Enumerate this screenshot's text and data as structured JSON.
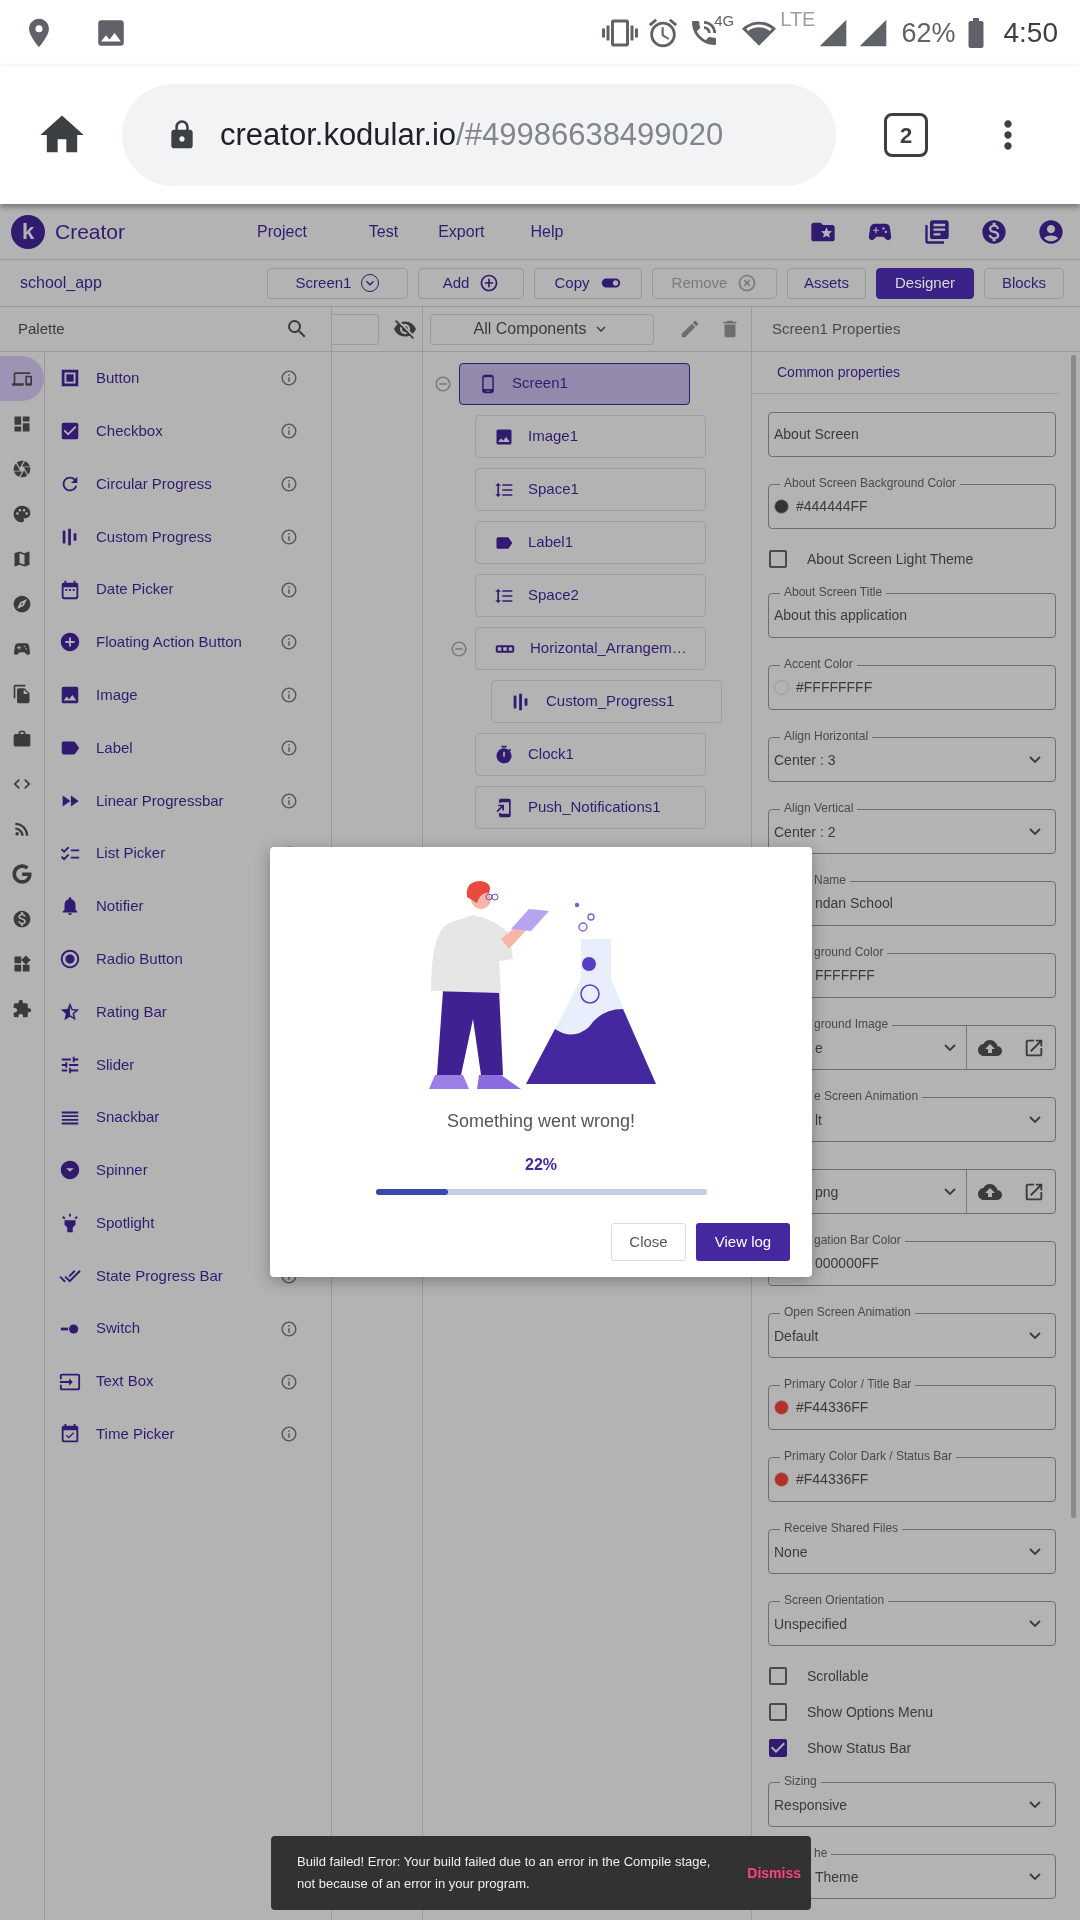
{
  "status_bar": {
    "network": "4G",
    "lte": "LTE",
    "battery": "62%",
    "time": "4:50"
  },
  "browser": {
    "url_host": "creator.kodular.io",
    "url_path": "/#49986638499020",
    "tab_count": "2"
  },
  "app_header": {
    "logo": "k",
    "title": "Creator",
    "menu": [
      "Project",
      "Test",
      "Export",
      "Help"
    ]
  },
  "toolbar": {
    "project": "school_app",
    "actions": [
      {
        "label": "Screen1",
        "kind": "dropdown",
        "disabled": false
      },
      {
        "label": "Add",
        "kind": "add",
        "disabled": false
      },
      {
        "label": "Copy",
        "kind": "copy",
        "disabled": false
      },
      {
        "label": "Remove",
        "kind": "remove",
        "disabled": true
      }
    ],
    "views": [
      {
        "label": "Assets",
        "selected": false
      },
      {
        "label": "Designer",
        "selected": true
      },
      {
        "label": "Blocks",
        "selected": false
      }
    ]
  },
  "palette": {
    "title": "Palette",
    "rail": [
      {
        "kind": "devices",
        "selected": true
      },
      {
        "kind": "layout",
        "selected": false
      },
      {
        "kind": "media",
        "selected": false
      },
      {
        "kind": "palette",
        "selected": false
      },
      {
        "kind": "map",
        "selected": false
      },
      {
        "kind": "compass",
        "selected": false
      },
      {
        "kind": "gaming",
        "selected": false
      },
      {
        "kind": "files",
        "selected": false
      },
      {
        "kind": "work",
        "selected": false
      },
      {
        "kind": "code",
        "selected": false
      },
      {
        "kind": "feed",
        "selected": false
      },
      {
        "kind": "google",
        "selected": false
      },
      {
        "kind": "money",
        "selected": false
      },
      {
        "kind": "widgets",
        "selected": false
      },
      {
        "kind": "extension",
        "selected": false
      }
    ],
    "items": [
      {
        "label": "Button",
        "kind": "button"
      },
      {
        "label": "Checkbox",
        "kind": "checkbox"
      },
      {
        "label": "Circular Progress",
        "kind": "circular"
      },
      {
        "label": "Custom Progress",
        "kind": "bars"
      },
      {
        "label": "Date Picker",
        "kind": "date"
      },
      {
        "label": "Floating Action Button",
        "kind": "fab"
      },
      {
        "label": "Image",
        "kind": "image"
      },
      {
        "label": "Label",
        "kind": "label"
      },
      {
        "label": "Linear Progressbar",
        "kind": "linear"
      },
      {
        "label": "List Picker",
        "kind": "list"
      },
      {
        "label": "Notifier",
        "kind": "notifier",
        "info_hidden": true
      },
      {
        "label": "Radio Button",
        "kind": "radio",
        "info_hidden": true
      },
      {
        "label": "Rating Bar",
        "kind": "rating",
        "info_hidden": true
      },
      {
        "label": "Slider",
        "kind": "slider",
        "info_hidden": true
      },
      {
        "label": "Snackbar",
        "kind": "snackbar",
        "info_hidden": true
      },
      {
        "label": "Spinner",
        "kind": "spinner",
        "info_hidden": true
      },
      {
        "label": "Spotlight",
        "kind": "spotlight",
        "info_hidden": true
      },
      {
        "label": "State Progress Bar",
        "kind": "state"
      },
      {
        "label": "Switch",
        "kind": "switch"
      },
      {
        "label": "Text Box",
        "kind": "textbox"
      },
      {
        "label": "Time Picker",
        "kind": "time"
      }
    ]
  },
  "components": {
    "filter": "All Components",
    "tree": [
      {
        "label": "Screen1",
        "kind": "screen",
        "selected": true,
        "expanded": true,
        "children": [
          {
            "label": "Image1",
            "kind": "image",
            "selected": false
          },
          {
            "label": "Space1",
            "kind": "space",
            "selected": false
          },
          {
            "label": "Label1",
            "kind": "label",
            "selected": false
          },
          {
            "label": "Space2",
            "kind": "space",
            "selected": false
          },
          {
            "label": "Horizontal_Arrangem…",
            "kind": "horizontal",
            "selected": false,
            "expanded": true,
            "children": [
              {
                "label": "Custom_Progress1",
                "kind": "bars",
                "selected": false
              }
            ]
          },
          {
            "label": "Clock1",
            "kind": "clock",
            "selected": false
          },
          {
            "label": "Push_Notifications1",
            "kind": "push",
            "selected": false
          }
        ]
      }
    ]
  },
  "properties": {
    "title": "Screen1 Properties",
    "tab": "Common properties",
    "fields": [
      {
        "kind": "button",
        "value": "About Screen"
      },
      {
        "kind": "color",
        "label": "About Screen Background Color",
        "value": "#444444FF",
        "color": "#333333"
      },
      {
        "kind": "checkbox",
        "label": "About Screen Light Theme",
        "checked": false
      },
      {
        "kind": "text",
        "label": "About Screen Title",
        "value": "About this application"
      },
      {
        "kind": "color",
        "label": "Accent Color",
        "value": "#FFFFFFFF",
        "color": "#b3b3b3"
      },
      {
        "kind": "select",
        "label": "Align Horizontal",
        "value": "Center : 3"
      },
      {
        "kind": "select",
        "label": "Align Vertical",
        "value": "Center : 2"
      },
      {
        "kind": "text",
        "label": "Name",
        "value": "ndan School",
        "covered": true
      },
      {
        "kind": "text",
        "label": "ground Color",
        "value": "FFFFFFF",
        "covered": true
      },
      {
        "kind": "asset",
        "label": "ground Image",
        "value": "e",
        "covered": true
      },
      {
        "kind": "select",
        "label": "e Screen Animation",
        "value": "lt",
        "covered": true
      },
      {
        "kind": "asset",
        "value": "png",
        "covered": true
      },
      {
        "kind": "text",
        "label": "gation Bar Color",
        "value": "000000FF",
        "covered": true
      },
      {
        "kind": "select",
        "label": "Open Screen Animation",
        "value": "Default"
      },
      {
        "kind": "color",
        "label": "Primary Color / Title Bar",
        "value": "#F44336FF",
        "color": "#b3302a"
      },
      {
        "kind": "color",
        "label": "Primary Color Dark / Status Bar",
        "value": "#F44336FF",
        "color": "#b3302a"
      },
      {
        "kind": "select",
        "label": "Receive Shared Files",
        "value": "None"
      },
      {
        "kind": "select",
        "label": "Screen Orientation",
        "value": "Unspecified"
      },
      {
        "kind": "checkbox",
        "label": "Scrollable",
        "checked": false
      },
      {
        "kind": "checkbox",
        "label": "Show Options Menu",
        "checked": false
      },
      {
        "kind": "checkbox",
        "label": "Show Status Bar",
        "checked": true
      },
      {
        "kind": "select",
        "label": "Sizing",
        "value": "Responsive"
      },
      {
        "kind": "select",
        "label": "he",
        "value": "Theme",
        "covered": true
      }
    ]
  },
  "dialog": {
    "message": "Something went wrong!",
    "progress_text": "22%",
    "level": 0.22,
    "buttons": [
      {
        "label": "Close",
        "kind": "secondary"
      },
      {
        "label": "View log",
        "kind": "primary"
      }
    ]
  },
  "snackbar": {
    "message": "Build failed! Error: Your build failed due to an error in the Compile stage, not because of an error in your program.",
    "action": "Dismiss"
  }
}
